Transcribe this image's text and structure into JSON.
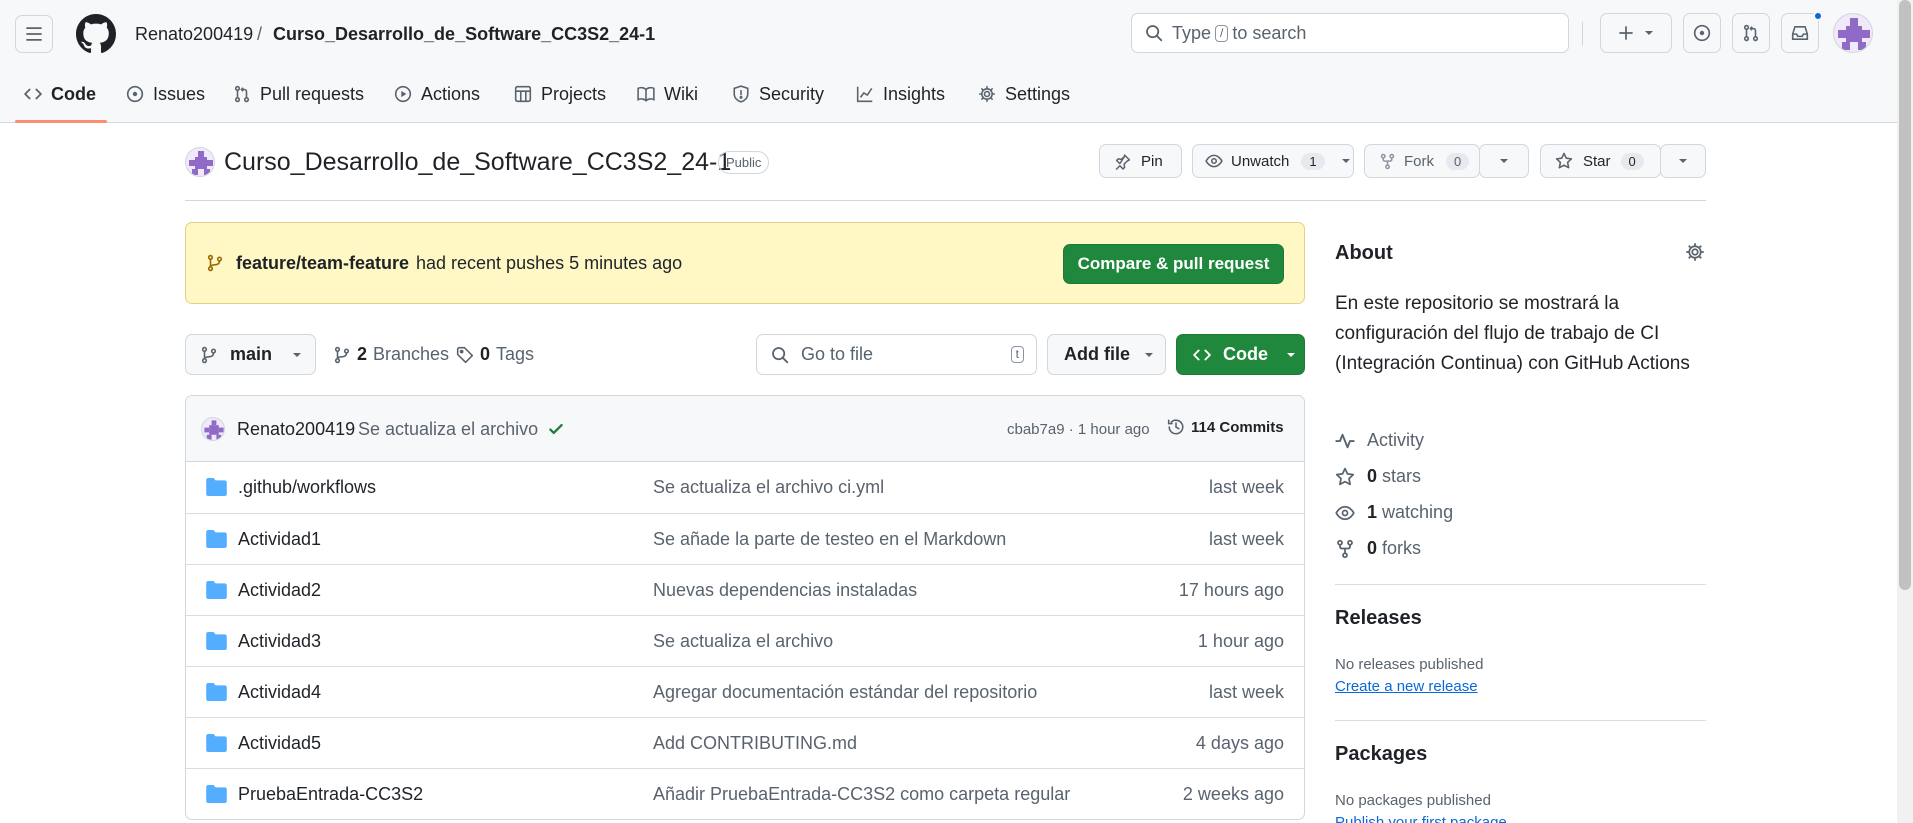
{
  "header": {
    "owner": "Renato200419",
    "separator": "/",
    "repo": "Curso_Desarrollo_de_Software_CC3S2_24-1",
    "search": {
      "prefix": "Type",
      "key": "/",
      "suffix": "to search"
    }
  },
  "tabs": [
    {
      "label": "Code",
      "icon": "code-icon",
      "active": true
    },
    {
      "label": "Issues",
      "icon": "issue-icon"
    },
    {
      "label": "Pull requests",
      "icon": "pull-request-icon"
    },
    {
      "label": "Actions",
      "icon": "play-icon"
    },
    {
      "label": "Projects",
      "icon": "table-icon"
    },
    {
      "label": "Wiki",
      "icon": "book-icon"
    },
    {
      "label": "Security",
      "icon": "shield-icon"
    },
    {
      "label": "Insights",
      "icon": "graph-icon"
    },
    {
      "label": "Settings",
      "icon": "gear-icon"
    }
  ],
  "repo_head": {
    "title": "Curso_Desarrollo_de_Software_CC3S2_24-1",
    "visibility": "Public",
    "pin": "Pin",
    "unwatch": "Unwatch",
    "watch_count": "1",
    "fork": "Fork",
    "fork_count": "0",
    "star": "Star",
    "star_count": "0"
  },
  "banner": {
    "branch": "feature/team-feature",
    "text": "had recent pushes 5 minutes ago",
    "button": "Compare & pull request"
  },
  "toolbar": {
    "branch": "main",
    "branches_count": "2",
    "branches_label": "Branches",
    "tags_count": "0",
    "tags_label": "Tags",
    "goto_placeholder": "Go to file",
    "goto_key": "t",
    "add_file": "Add file",
    "code": "Code"
  },
  "latest_commit": {
    "author": "Renato200419",
    "message": "Se actualiza el archivo",
    "hash_time": "cbab7a9 · 1 hour ago",
    "commits": "114 Commits"
  },
  "files": [
    {
      "name": ".github/workflows",
      "message": "Se actualiza el archivo ci.yml",
      "time": "last week"
    },
    {
      "name": "Actividad1",
      "message": "Se añade la parte de testeo en el Markdown",
      "time": "last week"
    },
    {
      "name": "Actividad2",
      "message": "Nuevas dependencias instaladas",
      "time": "17 hours ago"
    },
    {
      "name": "Actividad3",
      "message": "Se actualiza el archivo",
      "time": "1 hour ago"
    },
    {
      "name": "Actividad4",
      "message": "Agregar documentación estándar del repositorio",
      "time": "last week"
    },
    {
      "name": "Actividad5",
      "message": "Add CONTRIBUTING.md",
      "time": "4 days ago"
    },
    {
      "name": "PruebaEntrada-CC3S2",
      "message": "Añadir PruebaEntrada-CC3S2 como carpeta regular",
      "time": "2 weeks ago"
    }
  ],
  "about": {
    "heading": "About",
    "description": "En este repositorio se mostrará la configuración del flujo de trabajo de CI (Integración Continua) con GitHub Actions",
    "activity": "Activity",
    "stars_count": "0",
    "stars_label": "stars",
    "watching_count": "1",
    "watching_label": "watching",
    "forks_count": "0",
    "forks_label": "forks"
  },
  "releases": {
    "heading": "Releases",
    "empty": "No releases published",
    "link": "Create a new release"
  },
  "packages": {
    "heading": "Packages",
    "empty": "No packages published",
    "link": "Publish your first package"
  },
  "colors": {
    "accent_green": "#1f883d",
    "link_blue": "#0969da",
    "banner_bg": "#fff8c5",
    "tab_underline": "#fd8c73",
    "avatar_purple": "#8f6ac7"
  }
}
